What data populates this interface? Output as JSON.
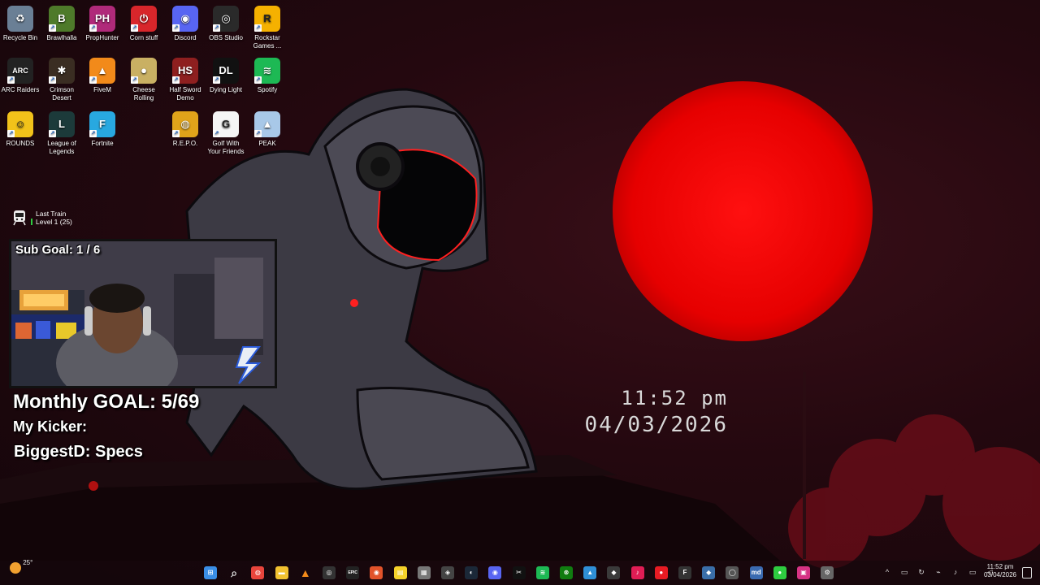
{
  "desktop_icons": [
    {
      "label": "Recycle Bin",
      "icon": "recycle-bin-icon",
      "color": "#6a7f95",
      "glyph": "♻",
      "shortcut": false
    },
    {
      "label": "Brawlhalla",
      "icon": "brawlhalla-icon",
      "color": "#4e7a2a",
      "glyph": "B",
      "shortcut": true
    },
    {
      "label": "PropHunter",
      "icon": "prophunter-icon",
      "color": "#b02a7a",
      "glyph": "PH",
      "shortcut": true
    },
    {
      "label": "Corn stuff",
      "icon": "power-icon",
      "color": "#d8262b",
      "glyph": "⏻",
      "shortcut": true
    },
    {
      "label": "Discord",
      "icon": "discord-icon",
      "color": "#5865f2",
      "glyph": "◉",
      "shortcut": true
    },
    {
      "label": "OBS Studio",
      "icon": "obs-icon",
      "color": "#2a2a2a",
      "glyph": "◎",
      "shortcut": true
    },
    {
      "label": "Rockstar Games ...",
      "icon": "rockstar-icon",
      "color": "#f5b100",
      "glyph": "R",
      "shortcut": true
    },
    {
      "label": "ARC Raiders",
      "icon": "arc-raiders-icon",
      "color": "#222222",
      "glyph": "ARC",
      "shortcut": true
    },
    {
      "label": "Crimson Desert",
      "icon": "crimson-desert-icon",
      "color": "#3a2d22",
      "glyph": "✱",
      "shortcut": true
    },
    {
      "label": "FiveM",
      "icon": "fivem-icon",
      "color": "#f28a1a",
      "glyph": "▲",
      "shortcut": true
    },
    {
      "label": "Cheese Rolling",
      "icon": "cheese-rolling-icon",
      "color": "#c9b063",
      "glyph": "●",
      "shortcut": true
    },
    {
      "label": "Half Sword Demo",
      "icon": "half-sword-icon",
      "color": "#8e1f1f",
      "glyph": "HS",
      "shortcut": true
    },
    {
      "label": "Dying Light",
      "icon": "dying-light-icon",
      "color": "#111111",
      "glyph": "DL",
      "shortcut": true
    },
    {
      "label": "Spotify",
      "icon": "spotify-icon",
      "color": "#1db954",
      "glyph": "≋",
      "shortcut": true
    },
    {
      "label": "ROUNDS",
      "icon": "rounds-icon",
      "color": "#f2c21a",
      "glyph": "☺",
      "shortcut": true
    },
    {
      "label": "League of Legends",
      "icon": "league-icon",
      "color": "#1c3a3a",
      "glyph": "L",
      "shortcut": true
    },
    {
      "label": "Fortnite",
      "icon": "fortnite-icon",
      "color": "#28a8e0",
      "glyph": "F",
      "shortcut": true
    },
    {
      "label": "R.E.P.O.",
      "icon": "repo-icon",
      "color": "#e0a31a",
      "glyph": "◍",
      "shortcut": true
    },
    {
      "label": "Golf With Your Friends",
      "icon": "golf-icon",
      "color": "#f5f5f5",
      "glyph": "G",
      "shortcut": true
    },
    {
      "label": "PEAK",
      "icon": "peak-icon",
      "color": "#a8c8e8",
      "glyph": "▲",
      "shortcut": true
    }
  ],
  "train_widget": {
    "title": "Last Train",
    "subtitle": "Level 1  (25)"
  },
  "overlay": {
    "sub_goal": "Sub Goal:  1 / 6",
    "monthly_goal": "Monthly GOAL: 5/69",
    "kicker": "My Kicker:",
    "biggest": "BiggestD: Specs"
  },
  "desktop_clock": {
    "time": "11:52  pm",
    "date": "04/03/2026"
  },
  "taskbar": {
    "weather": "25°",
    "apps": [
      {
        "name": "start-button",
        "color": "#3a8ee6",
        "glyph": "⊞"
      },
      {
        "name": "search-icon",
        "color": "transparent",
        "glyph": "⌕"
      },
      {
        "name": "chrome-icon",
        "color": "#e8453c",
        "glyph": "◍"
      },
      {
        "name": "file-explorer-icon",
        "color": "#f2c230",
        "glyph": "▬"
      },
      {
        "name": "vlc-icon",
        "color": "transparent",
        "glyph": "▲"
      },
      {
        "name": "obs-taskbar-icon",
        "color": "#333",
        "glyph": "◎"
      },
      {
        "name": "epic-games-icon",
        "color": "#222",
        "glyph": "EPIC"
      },
      {
        "name": "firefox-icon",
        "color": "#e2532a",
        "glyph": "◉"
      },
      {
        "name": "sticky-notes-icon",
        "color": "#f5d22a",
        "glyph": "▤"
      },
      {
        "name": "app-gray-icon",
        "color": "#777",
        "glyph": "▦"
      },
      {
        "name": "app-steam-vr-icon",
        "color": "#444",
        "glyph": "◈"
      },
      {
        "name": "steam-icon",
        "color": "#1b2838",
        "glyph": "◐"
      },
      {
        "name": "discord-taskbar-icon",
        "color": "#5865f2",
        "glyph": "◉"
      },
      {
        "name": "capcut-icon",
        "color": "#111",
        "glyph": "✂"
      },
      {
        "name": "spotify-taskbar-icon",
        "color": "#1db954",
        "glyph": "≋"
      },
      {
        "name": "xbox-icon",
        "color": "#107c10",
        "glyph": "⊗"
      },
      {
        "name": "photos-icon",
        "color": "#2f8fd6",
        "glyph": "▲"
      },
      {
        "name": "nvidia-icon",
        "color": "#3a3a3a",
        "glyph": "◆"
      },
      {
        "name": "tiktok-icon",
        "color": "#e01d55",
        "glyph": "♪"
      },
      {
        "name": "record-icon",
        "color": "#e81b23",
        "glyph": "●"
      },
      {
        "name": "figma-icon",
        "color": "#333",
        "glyph": "F"
      },
      {
        "name": "app-diamond-icon",
        "color": "#3a6ea8",
        "glyph": "◆"
      },
      {
        "name": "app-circle-icon",
        "color": "#555",
        "glyph": "◯"
      },
      {
        "name": "mdk-icon",
        "color": "#3a6ab0",
        "glyph": "md"
      },
      {
        "name": "app-green-icon",
        "color": "#2ecc40",
        "glyph": "●"
      },
      {
        "name": "app-pink-icon",
        "color": "#d63384",
        "glyph": "▣"
      },
      {
        "name": "settings-icon",
        "color": "#666",
        "glyph": "⚙"
      }
    ],
    "tray": [
      {
        "name": "chevron-up-icon",
        "glyph": "^"
      },
      {
        "name": "tray-app-icon",
        "glyph": "▭"
      },
      {
        "name": "tray-network-sync-icon",
        "glyph": "↻"
      },
      {
        "name": "tray-usb-icon",
        "glyph": "⌁"
      },
      {
        "name": "microphone-icon",
        "glyph": "♪"
      },
      {
        "name": "display-icon",
        "glyph": "▭"
      },
      {
        "name": "volume-icon",
        "glyph": "◁"
      }
    ],
    "clock_time": "11:52 pm",
    "clock_date": "03/04/2026"
  }
}
